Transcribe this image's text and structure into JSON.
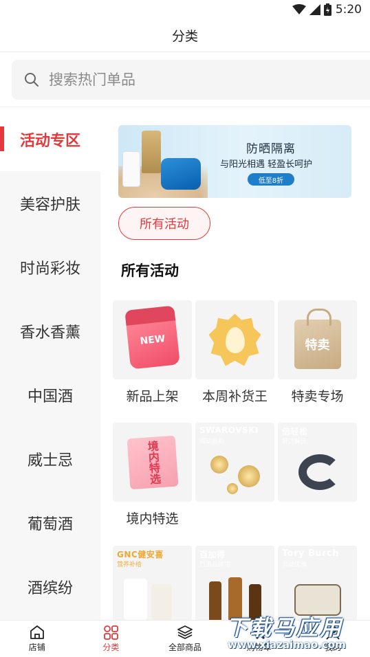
{
  "status_bar": {
    "time": "5:20"
  },
  "header": {
    "title": "分类"
  },
  "search": {
    "placeholder": "搜索热门单品"
  },
  "sidebar": {
    "items": [
      {
        "label": "活动专区",
        "active": true
      },
      {
        "label": "美容护肤",
        "active": false
      },
      {
        "label": "时尚彩妆",
        "active": false
      },
      {
        "label": "香水香薰",
        "active": false
      },
      {
        "label": "中国酒",
        "active": false
      },
      {
        "label": "威士忌",
        "active": false
      },
      {
        "label": "葡萄酒",
        "active": false
      },
      {
        "label": "酒缤纷",
        "active": false
      }
    ]
  },
  "banner": {
    "title": "防晒隔离",
    "subtitle": "与阳光相遇 轻盈长呵护",
    "badge": "低至8折"
  },
  "filter_pill": {
    "label": "所有活动"
  },
  "section": {
    "title": "所有活动"
  },
  "tiles": [
    {
      "label": "新品上架",
      "art_text": "NEW"
    },
    {
      "label": "本周补货王"
    },
    {
      "label": "特卖专场",
      "art_text": "特卖"
    },
    {
      "label": "境内特选",
      "art_text": "境内特选"
    },
    {
      "label": "",
      "art_text": "SWAROVSKI",
      "art_sub": "耀动晶彩"
    },
    {
      "label": "",
      "art_text": "倍轻松",
      "art_sub": "舒适解压"
    },
    {
      "label": "",
      "art_text": "GNC健安喜",
      "art_sub": "营养补给"
    },
    {
      "label": "",
      "art_text": "百加得",
      "art_sub": "烈酒品牌馆"
    },
    {
      "label": "",
      "art_text": "Tory Burch",
      "art_sub": "灵动优雅"
    }
  ],
  "tabbar": {
    "tabs": [
      {
        "label": "店铺",
        "icon": "home-icon",
        "active": false
      },
      {
        "label": "分类",
        "icon": "category-icon",
        "active": true
      },
      {
        "label": "全部商品",
        "icon": "layers-icon",
        "active": false
      },
      {
        "label": "购物车",
        "icon": "cart-icon",
        "active": false
      },
      {
        "label": "我的",
        "icon": "user-icon",
        "active": false
      }
    ]
  },
  "watermark": {
    "text": "下载马应用",
    "url": "www.xiazaimao.com"
  },
  "colors": {
    "accent": "#e4393c",
    "sidebar_bg": "#f7f7f7",
    "search_bg": "#f5f5f5"
  }
}
